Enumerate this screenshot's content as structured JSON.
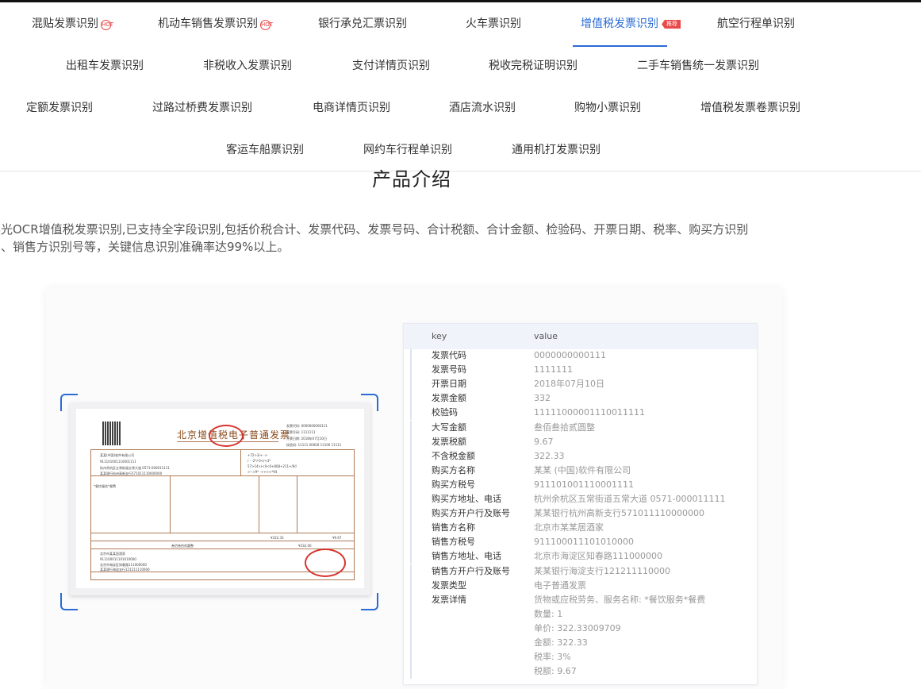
{
  "nav": {
    "items": [
      {
        "label": "混贴发票识别",
        "badge": "HOT"
      },
      {
        "label": "机动车销售发票识别",
        "badge": "HOT"
      },
      {
        "label": "银行承兑汇票识别"
      },
      {
        "label": "火车票识别"
      },
      {
        "label": "增值税发票识别",
        "badge": "推荐",
        "active": true
      },
      {
        "label": "航空行程单识别"
      },
      {
        "label": "出租车发票识别"
      },
      {
        "label": "非税收入发票识别"
      },
      {
        "label": "支付详情页识别"
      },
      {
        "label": "税收完税证明识别"
      },
      {
        "label": "二手车销售统一发票识别"
      },
      {
        "label": "定额发票识别"
      },
      {
        "label": "过路过桥费发票识别"
      },
      {
        "label": "电商详情页识别"
      },
      {
        "label": "酒店流水识别"
      },
      {
        "label": "购物小票识别"
      },
      {
        "label": "增值税发票卷票识别"
      },
      {
        "label": "客运车船票识别"
      },
      {
        "label": "网约车行程单识别"
      },
      {
        "label": "通用机打发票识别"
      }
    ]
  },
  "main": {
    "title": "产品介绍",
    "desc_line1": "读光OCR增值税发票识别,已支持全字段识别,包括价税合计、发票代码、发票号码、合计税额、合计金额、检验码、开票日期、税率、购买方识别",
    "desc_line2": "号、销售方识别号等，关键信息识别准确率达99%以上。"
  },
  "invoice": {
    "title": "北京增值税电子普通发票",
    "buyer_name": "某某(中国)软件有限公司",
    "buyer_tax_id": "911101001110001111",
    "buyer_addr": "杭州余杭区五常街道五常大道 0571-000011111",
    "buyer_bank": "某某银行杭州高新支行571011110000000",
    "item": "*餐饮服务*餐费",
    "amount": "¥322.33",
    "tax": "¥9.67",
    "total_words": "叁佰叁拾贰圆整",
    "total": "¥332.00",
    "seller_name": "北京市某某居酒家",
    "seller_tax_id": "911100011101010000",
    "seller_addr": "北京市海淀区知春路111000000",
    "seller_bank": "某某银行海淀支行121211110000",
    "cipher": [
      "+72>3/+            ->",
      "/        -     -2*/-0</+3*",
      "57>14>/<0<0+808+211+/9//",
      ">-->9*           -++<<*94"
    ],
    "code_label": "发票代码: 0000000000111",
    "no_label": "发票号码: 1111111",
    "date_label": "开票日期: 2018年07月10日",
    "check_label": "校验码: 11111 00000 11100 11111"
  },
  "table": {
    "key_header": "key",
    "value_header": "value",
    "rows": [
      {
        "k": "发票代码",
        "v": "0000000000111"
      },
      {
        "k": "发票号码",
        "v": "1111111"
      },
      {
        "k": "开票日期",
        "v": "2018年07月10日"
      },
      {
        "k": "发票金额",
        "v": "332"
      },
      {
        "k": "校验码",
        "v": "11111000001110011111"
      },
      {
        "k": "大写金额",
        "v": "叁佰叁拾贰圆整"
      },
      {
        "k": "发票税额",
        "v": "9.67"
      },
      {
        "k": "不含税金额",
        "v": "322.33"
      },
      {
        "k": "购买方名称",
        "v": "某某 (中国)软件有限公司"
      },
      {
        "k": "购买方税号",
        "v": "911101001110001111"
      },
      {
        "k": "购买方地址、电话",
        "v": "杭州余杭区五常街道五常大道 0571-000011111"
      },
      {
        "k": "购买方开户行及账号",
        "v": "某某银行杭州高新支行571011110000000"
      },
      {
        "k": "销售方名称",
        "v": "北京市某某居酒家"
      },
      {
        "k": "销售方税号",
        "v": "911100011101010000"
      },
      {
        "k": "销售方地址、电话",
        "v": "北京市海淀区知春路111000000"
      },
      {
        "k": "销售方开户行及账号",
        "v": "某某银行海淀支行121211110000"
      },
      {
        "k": "发票类型",
        "v": "电子普通发票"
      },
      {
        "k": "发票详情",
        "v": "货物或应税劳务、服务名称: *餐饮服务*餐费"
      },
      {
        "k": "",
        "v": "数量: 1"
      },
      {
        "k": "",
        "v": "单价: 322.33009709"
      },
      {
        "k": "",
        "v": "金额: 322.33"
      },
      {
        "k": "",
        "v": "税率: 3%"
      },
      {
        "k": "",
        "v": "税额: 9.67"
      }
    ]
  },
  "colors": {
    "accent": "#2a6bd6",
    "badge": "#e84a4a",
    "stamp": "#d6342f"
  }
}
